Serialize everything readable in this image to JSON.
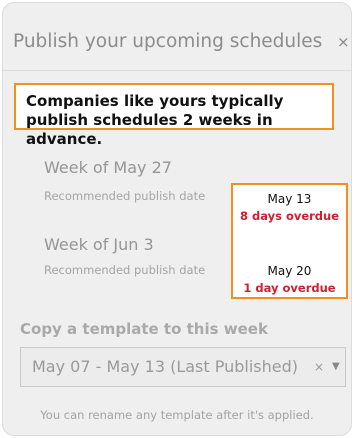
{
  "dialog": {
    "title": "Publish your upcoming schedules",
    "close_symbol": "×",
    "callout": "Companies like yours typically publish schedules 2 weeks in advance.",
    "weeks": [
      {
        "label": "Week of May 27",
        "rec_label": "Recommended publish date",
        "date": "May 13",
        "overdue": "8 days overdue"
      },
      {
        "label": "Week of Jun 3",
        "rec_label": "Recommended publish date",
        "date": "May 20",
        "overdue": "1 day overdue"
      }
    ],
    "copy_label": "Copy a template to this week",
    "template_select": {
      "value": "May 07 - May 13 (Last Published)",
      "clear_symbol": "×",
      "arrow_symbol": "▼"
    },
    "hint": "You can rename any template after it's applied."
  },
  "colors": {
    "highlight": "#f0901e",
    "overdue": "#d0202f",
    "panel_bg": "#efefef"
  },
  "icons": [
    "close-icon",
    "clear-icon",
    "chevron-down-icon"
  ]
}
